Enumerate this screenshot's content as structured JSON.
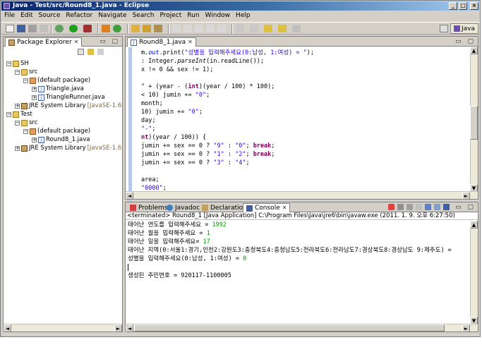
{
  "window": {
    "title": "Java - Test/src/Round8_1.java - Eclipse"
  },
  "window_buttons": {
    "minimize": "_",
    "maximize": "□",
    "close": "×"
  },
  "menu": [
    "File",
    "Edit",
    "Source",
    "Refactor",
    "Navigate",
    "Search",
    "Project",
    "Run",
    "Window",
    "Help"
  ],
  "perspective": {
    "label": "Java"
  },
  "package_explorer": {
    "tab_label": "Package Explorer",
    "tree": [
      {
        "label": "SH",
        "suffix": ""
      },
      {
        "label": "src",
        "suffix": ""
      },
      {
        "label": "(default package)",
        "suffix": ""
      },
      {
        "label": "Triangle.java",
        "suffix": ""
      },
      {
        "label": "TriangleRunner.java",
        "suffix": ""
      },
      {
        "label": "JRE System Library",
        "suffix": "[JavaSE-1.6"
      },
      {
        "label": "Test",
        "suffix": ""
      },
      {
        "label": "src",
        "suffix": ""
      },
      {
        "label": "(default package)",
        "suffix": ""
      },
      {
        "label": "Round8_1.java",
        "suffix": ""
      },
      {
        "label": "JRE System Library",
        "suffix": "[JavaSE-1.6"
      }
    ]
  },
  "editor": {
    "tab_label": "Round8_1.java",
    "lines": [
      [
        [
          "m.",
          ""
        ],
        [
          "out",
          "fld"
        ],
        [
          ".print(",
          ""
        ],
        [
          "\"성별을 입력해주세요(0:남성, 1:여성) = \"",
          "str"
        ],
        [
          ");",
          ""
        ]
      ],
      [
        [
          ": Integer.",
          ""
        ],
        [
          "parseInt",
          "mth"
        ],
        [
          "(in.readLine());",
          ""
        ]
      ],
      [
        [
          "x != 0 && sex != 1);",
          ""
        ]
      ],
      [
        [
          "",
          ""
        ]
      ],
      [
        [
          "\" + (year - (",
          ""
        ],
        [
          "int",
          "kw"
        ],
        [
          ")(year / 100) * 100);",
          ""
        ]
      ],
      [
        [
          "< 10) jumin += ",
          ""
        ],
        [
          "\"0\"",
          "str"
        ],
        [
          ";",
          ""
        ]
      ],
      [
        [
          "month;",
          ""
        ]
      ],
      [
        [
          "10) jumin += ",
          ""
        ],
        [
          "\"0\"",
          "str"
        ],
        [
          ";",
          ""
        ]
      ],
      [
        [
          "day;",
          ""
        ]
      ],
      [
        [
          "\"-\"",
          "str"
        ],
        [
          ";",
          ""
        ]
      ],
      [
        [
          "nt",
          "kw"
        ],
        [
          ")(year / 100)) {",
          ""
        ]
      ],
      [
        [
          "jumin += sex == 0 ? ",
          ""
        ],
        [
          "\"9\"",
          "str"
        ],
        [
          " : ",
          ""
        ],
        [
          "\"0\"",
          "str"
        ],
        [
          "; ",
          ""
        ],
        [
          "break",
          "kw"
        ],
        [
          ";",
          ""
        ]
      ],
      [
        [
          "jumin += sex == 0 ? ",
          ""
        ],
        [
          "\"1\"",
          "str"
        ],
        [
          " : ",
          ""
        ],
        [
          "\"2\"",
          "str"
        ],
        [
          "; ",
          ""
        ],
        [
          "break",
          "kw"
        ],
        [
          ";",
          ""
        ]
      ],
      [
        [
          "jumin += sex == 0 ? ",
          ""
        ],
        [
          "\"3\"",
          "str"
        ],
        [
          " : ",
          ""
        ],
        [
          "\"4\"",
          "str"
        ],
        [
          ";",
          ""
        ]
      ],
      [
        [
          "",
          ""
        ]
      ],
      [
        [
          "area;",
          ""
        ]
      ],
      [
        [
          "\"0000\"",
          "str"
        ],
        [
          ";",
          ""
        ]
      ]
    ]
  },
  "bottom_tabs": {
    "problems": "Problems",
    "javadoc": "Javadoc",
    "declaration": "Declaration",
    "console": "Console"
  },
  "console": {
    "terminated": "<terminated> Round8_1 [Java Application] C:\\Program Files\\Java\\jre6\\bin\\javaw.exe (2011. 1. 9. 오후 6:27:50)",
    "lines": [
      {
        "prompt": "태어난 연도를 입력해주세요 = ",
        "input": "1992"
      },
      {
        "prompt": "태어난 월을 입력해주세요 = ",
        "input": "1"
      },
      {
        "prompt": "태어난 일을 입력해주세요= ",
        "input": "17"
      },
      {
        "prompt": "태어난 지역(0:서울1:경기,인천2:강원도3:충청북도4:충청남도5:전라북도6:전라남도7:경상북도8:경상남도 9:제주도) = ",
        "input": ""
      },
      {
        "prompt": "성별을 입력해주세요(0:남성, 1:여성) = ",
        "input": "0"
      },
      {
        "prompt": "",
        "input": ""
      },
      {
        "prompt": "생성된 주민번호 = 920117-1100005",
        "input": ""
      }
    ]
  }
}
